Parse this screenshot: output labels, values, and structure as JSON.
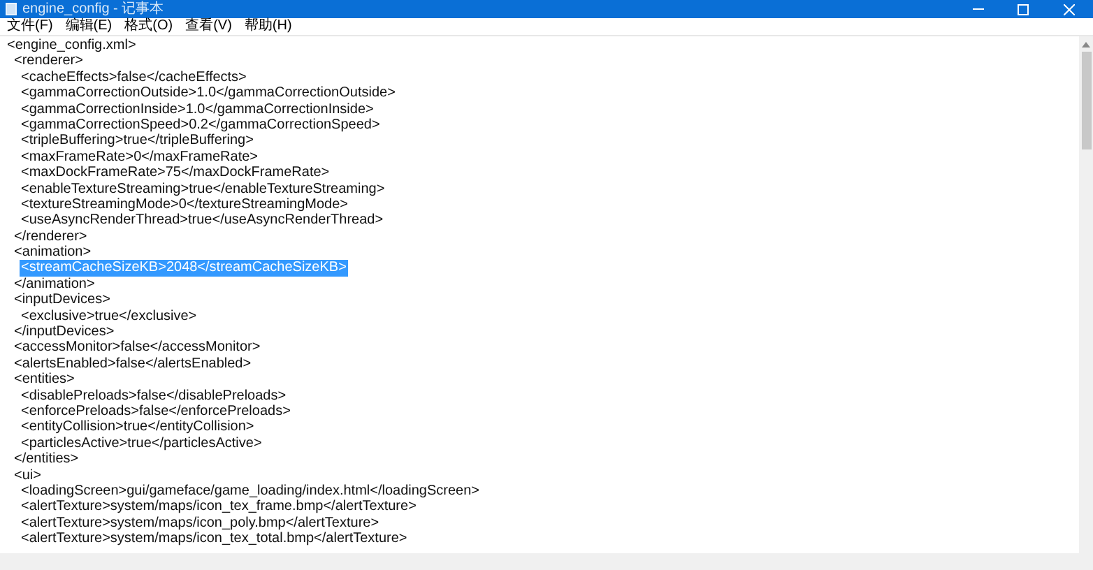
{
  "window": {
    "title": "engine_config - 记事本"
  },
  "menu": [
    "文件(F)",
    "编辑(E)",
    "格式(O)",
    "查看(V)",
    "帮助(H)"
  ],
  "document": {
    "text": "<engine_config.xml>",
    "selected": false,
    "children": [
      {
        "text": "<renderer>",
        "close": "</renderer>",
        "selected": false,
        "children": [
          {
            "text": "<cacheEffects>false</cacheEffects>",
            "selected": false
          },
          {
            "text": "<gammaCorrectionOutside>1.0</gammaCorrectionOutside>",
            "selected": false
          },
          {
            "text": "<gammaCorrectionInside>1.0</gammaCorrectionInside>",
            "selected": false
          },
          {
            "text": "<gammaCorrectionSpeed>0.2</gammaCorrectionSpeed>",
            "selected": false
          },
          {
            "text": "<tripleBuffering>true</tripleBuffering>",
            "selected": false
          },
          {
            "text": "<maxFrameRate>0</maxFrameRate>",
            "selected": false
          },
          {
            "text": "<maxDockFrameRate>75</maxDockFrameRate>",
            "selected": false
          },
          {
            "text": "<enableTextureStreaming>true</enableTextureStreaming>",
            "selected": false
          },
          {
            "text": "<textureStreamingMode>0</textureStreamingMode>",
            "selected": false
          },
          {
            "text": "<useAsyncRenderThread>true</useAsyncRenderThread>",
            "selected": false
          }
        ]
      },
      {
        "text": "<animation>",
        "close": "</animation>",
        "selected": false,
        "children": [
          {
            "text": "<streamCacheSizeKB>2048</streamCacheSizeKB>",
            "selected": true
          }
        ]
      },
      {
        "text": "<inputDevices>",
        "close": "</inputDevices>",
        "selected": false,
        "children": [
          {
            "text": "<exclusive>true</exclusive>",
            "selected": false
          }
        ]
      },
      {
        "text": "<accessMonitor>false</accessMonitor>",
        "selected": false
      },
      {
        "text": "<alertsEnabled>false</alertsEnabled>",
        "selected": false
      },
      {
        "text": "<entities>",
        "close": "</entities>",
        "selected": false,
        "children": [
          {
            "text": "<disablePreloads>false</disablePreloads>",
            "selected": false
          },
          {
            "text": "<enforcePreloads>false</enforcePreloads>",
            "selected": false
          },
          {
            "text": "<entityCollision>true</entityCollision>",
            "selected": false
          },
          {
            "text": "<particlesActive>true</particlesActive>",
            "selected": false
          }
        ]
      },
      {
        "text": "<ui>",
        "selected": false,
        "children": [
          {
            "text": "<loadingScreen>gui/gameface/game_loading/index.html</loadingScreen>",
            "selected": false
          },
          {
            "text": "<alertTexture>system/maps/icon_tex_frame.bmp</alertTexture>",
            "selected": false
          },
          {
            "text": "<alertTexture>system/maps/icon_poly.bmp</alertTexture>",
            "selected": false
          },
          {
            "text": "<alertTexture>system/maps/icon_tex_total.bmp</alertTexture>",
            "selected": false
          }
        ]
      }
    ]
  }
}
